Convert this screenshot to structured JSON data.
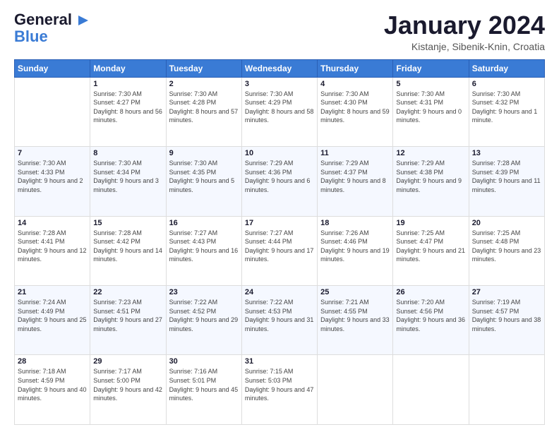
{
  "logo": {
    "line1": "General",
    "line2": "Blue"
  },
  "header": {
    "title": "January 2024",
    "subtitle": "Kistanje, Sibenik-Knin, Croatia"
  },
  "weekdays": [
    "Sunday",
    "Monday",
    "Tuesday",
    "Wednesday",
    "Thursday",
    "Friday",
    "Saturday"
  ],
  "weeks": [
    [
      {
        "day": "",
        "sunrise": "",
        "sunset": "",
        "daylight": ""
      },
      {
        "day": "1",
        "sunrise": "Sunrise: 7:30 AM",
        "sunset": "Sunset: 4:27 PM",
        "daylight": "Daylight: 8 hours and 56 minutes."
      },
      {
        "day": "2",
        "sunrise": "Sunrise: 7:30 AM",
        "sunset": "Sunset: 4:28 PM",
        "daylight": "Daylight: 8 hours and 57 minutes."
      },
      {
        "day": "3",
        "sunrise": "Sunrise: 7:30 AM",
        "sunset": "Sunset: 4:29 PM",
        "daylight": "Daylight: 8 hours and 58 minutes."
      },
      {
        "day": "4",
        "sunrise": "Sunrise: 7:30 AM",
        "sunset": "Sunset: 4:30 PM",
        "daylight": "Daylight: 8 hours and 59 minutes."
      },
      {
        "day": "5",
        "sunrise": "Sunrise: 7:30 AM",
        "sunset": "Sunset: 4:31 PM",
        "daylight": "Daylight: 9 hours and 0 minutes."
      },
      {
        "day": "6",
        "sunrise": "Sunrise: 7:30 AM",
        "sunset": "Sunset: 4:32 PM",
        "daylight": "Daylight: 9 hours and 1 minute."
      }
    ],
    [
      {
        "day": "7",
        "sunrise": "Sunrise: 7:30 AM",
        "sunset": "Sunset: 4:33 PM",
        "daylight": "Daylight: 9 hours and 2 minutes."
      },
      {
        "day": "8",
        "sunrise": "Sunrise: 7:30 AM",
        "sunset": "Sunset: 4:34 PM",
        "daylight": "Daylight: 9 hours and 3 minutes."
      },
      {
        "day": "9",
        "sunrise": "Sunrise: 7:30 AM",
        "sunset": "Sunset: 4:35 PM",
        "daylight": "Daylight: 9 hours and 5 minutes."
      },
      {
        "day": "10",
        "sunrise": "Sunrise: 7:29 AM",
        "sunset": "Sunset: 4:36 PM",
        "daylight": "Daylight: 9 hours and 6 minutes."
      },
      {
        "day": "11",
        "sunrise": "Sunrise: 7:29 AM",
        "sunset": "Sunset: 4:37 PM",
        "daylight": "Daylight: 9 hours and 8 minutes."
      },
      {
        "day": "12",
        "sunrise": "Sunrise: 7:29 AM",
        "sunset": "Sunset: 4:38 PM",
        "daylight": "Daylight: 9 hours and 9 minutes."
      },
      {
        "day": "13",
        "sunrise": "Sunrise: 7:28 AM",
        "sunset": "Sunset: 4:39 PM",
        "daylight": "Daylight: 9 hours and 11 minutes."
      }
    ],
    [
      {
        "day": "14",
        "sunrise": "Sunrise: 7:28 AM",
        "sunset": "Sunset: 4:41 PM",
        "daylight": "Daylight: 9 hours and 12 minutes."
      },
      {
        "day": "15",
        "sunrise": "Sunrise: 7:28 AM",
        "sunset": "Sunset: 4:42 PM",
        "daylight": "Daylight: 9 hours and 14 minutes."
      },
      {
        "day": "16",
        "sunrise": "Sunrise: 7:27 AM",
        "sunset": "Sunset: 4:43 PM",
        "daylight": "Daylight: 9 hours and 16 minutes."
      },
      {
        "day": "17",
        "sunrise": "Sunrise: 7:27 AM",
        "sunset": "Sunset: 4:44 PM",
        "daylight": "Daylight: 9 hours and 17 minutes."
      },
      {
        "day": "18",
        "sunrise": "Sunrise: 7:26 AM",
        "sunset": "Sunset: 4:46 PM",
        "daylight": "Daylight: 9 hours and 19 minutes."
      },
      {
        "day": "19",
        "sunrise": "Sunrise: 7:25 AM",
        "sunset": "Sunset: 4:47 PM",
        "daylight": "Daylight: 9 hours and 21 minutes."
      },
      {
        "day": "20",
        "sunrise": "Sunrise: 7:25 AM",
        "sunset": "Sunset: 4:48 PM",
        "daylight": "Daylight: 9 hours and 23 minutes."
      }
    ],
    [
      {
        "day": "21",
        "sunrise": "Sunrise: 7:24 AM",
        "sunset": "Sunset: 4:49 PM",
        "daylight": "Daylight: 9 hours and 25 minutes."
      },
      {
        "day": "22",
        "sunrise": "Sunrise: 7:23 AM",
        "sunset": "Sunset: 4:51 PM",
        "daylight": "Daylight: 9 hours and 27 minutes."
      },
      {
        "day": "23",
        "sunrise": "Sunrise: 7:22 AM",
        "sunset": "Sunset: 4:52 PM",
        "daylight": "Daylight: 9 hours and 29 minutes."
      },
      {
        "day": "24",
        "sunrise": "Sunrise: 7:22 AM",
        "sunset": "Sunset: 4:53 PM",
        "daylight": "Daylight: 9 hours and 31 minutes."
      },
      {
        "day": "25",
        "sunrise": "Sunrise: 7:21 AM",
        "sunset": "Sunset: 4:55 PM",
        "daylight": "Daylight: 9 hours and 33 minutes."
      },
      {
        "day": "26",
        "sunrise": "Sunrise: 7:20 AM",
        "sunset": "Sunset: 4:56 PM",
        "daylight": "Daylight: 9 hours and 36 minutes."
      },
      {
        "day": "27",
        "sunrise": "Sunrise: 7:19 AM",
        "sunset": "Sunset: 4:57 PM",
        "daylight": "Daylight: 9 hours and 38 minutes."
      }
    ],
    [
      {
        "day": "28",
        "sunrise": "Sunrise: 7:18 AM",
        "sunset": "Sunset: 4:59 PM",
        "daylight": "Daylight: 9 hours and 40 minutes."
      },
      {
        "day": "29",
        "sunrise": "Sunrise: 7:17 AM",
        "sunset": "Sunset: 5:00 PM",
        "daylight": "Daylight: 9 hours and 42 minutes."
      },
      {
        "day": "30",
        "sunrise": "Sunrise: 7:16 AM",
        "sunset": "Sunset: 5:01 PM",
        "daylight": "Daylight: 9 hours and 45 minutes."
      },
      {
        "day": "31",
        "sunrise": "Sunrise: 7:15 AM",
        "sunset": "Sunset: 5:03 PM",
        "daylight": "Daylight: 9 hours and 47 minutes."
      },
      {
        "day": "",
        "sunrise": "",
        "sunset": "",
        "daylight": ""
      },
      {
        "day": "",
        "sunrise": "",
        "sunset": "",
        "daylight": ""
      },
      {
        "day": "",
        "sunrise": "",
        "sunset": "",
        "daylight": ""
      }
    ]
  ]
}
